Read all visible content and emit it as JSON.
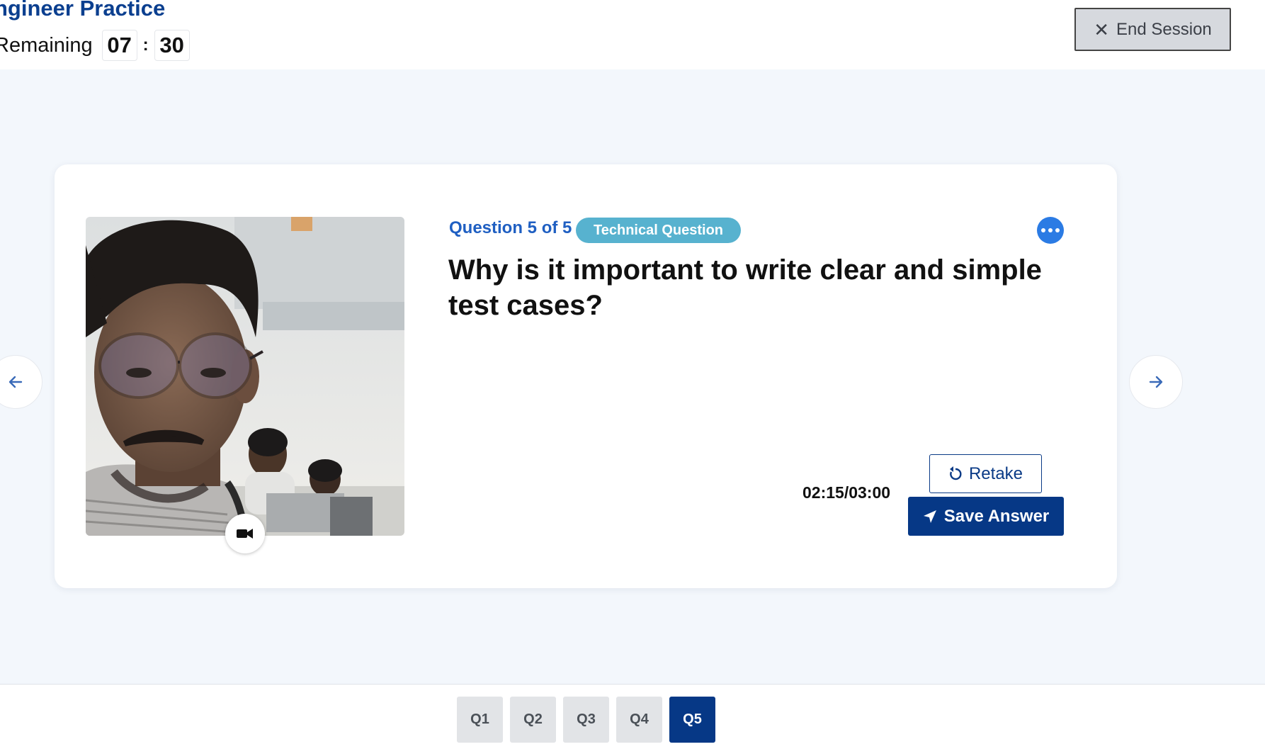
{
  "header": {
    "title": "ngineer Practice",
    "remaining_label": "Remaining",
    "timer_minutes": "07",
    "timer_separator": ":",
    "timer_seconds": "30",
    "end_session_label": "End Session"
  },
  "question": {
    "number_label": "Question 5 of 5",
    "type_badge": "Technical Question",
    "text": "Why is it important to write clear and simple test cases?"
  },
  "recording": {
    "time": "02:15/03:00",
    "retake_label": "Retake",
    "save_label": "Save Answer"
  },
  "question_tabs": [
    {
      "label": "Q1",
      "active": false
    },
    {
      "label": "Q2",
      "active": false
    },
    {
      "label": "Q3",
      "active": false
    },
    {
      "label": "Q4",
      "active": false
    },
    {
      "label": "Q5",
      "active": true
    }
  ],
  "colors": {
    "brand_blue": "#063886",
    "link_blue": "#1f5fc2",
    "badge_teal": "#57b2cf",
    "page_background": "#f3f7fc"
  },
  "icons": {
    "end_session": "close-icon",
    "more": "more-options-icon",
    "retake": "refresh-icon",
    "save": "send-icon",
    "camera": "video-camera-icon",
    "prev": "arrow-left-icon",
    "next": "arrow-right-icon"
  }
}
